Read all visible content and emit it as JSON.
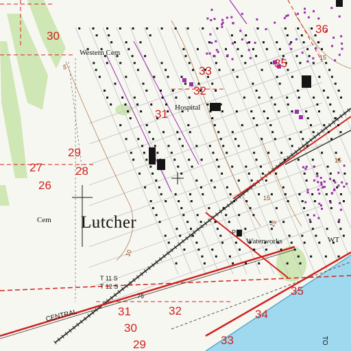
{
  "map": {
    "town_name": "Lutcher",
    "places": {
      "western_cem": "Western Cem",
      "hospital": "Hospital",
      "cem": "Cem",
      "waterworks": "Waterworks",
      "wt": "WT",
      "central": "CENTRAL",
      "to": "TO"
    },
    "township_labels": {
      "north": "T 11 S",
      "south": "T 12 S"
    },
    "contour_labels": [
      "5",
      "10",
      "15",
      "15",
      "15",
      "15"
    ],
    "misc_labels": [
      "76",
      "P"
    ],
    "section_numbers": [
      "30",
      "36",
      "33",
      "35",
      "32",
      "31",
      "29",
      "28",
      "27",
      "26",
      "35",
      "34",
      "33",
      "32",
      "31",
      "30",
      "29"
    ],
    "colors": {
      "background": "#f7f7f2",
      "woodland": "#cfe7b4",
      "river": "#9fd9f0",
      "section_lines": "#d0201c",
      "buildings": "#141414",
      "revision_purple": "#9a2fa8",
      "contour_brown": "#a56a3a",
      "road_dark": "#333333"
    }
  }
}
